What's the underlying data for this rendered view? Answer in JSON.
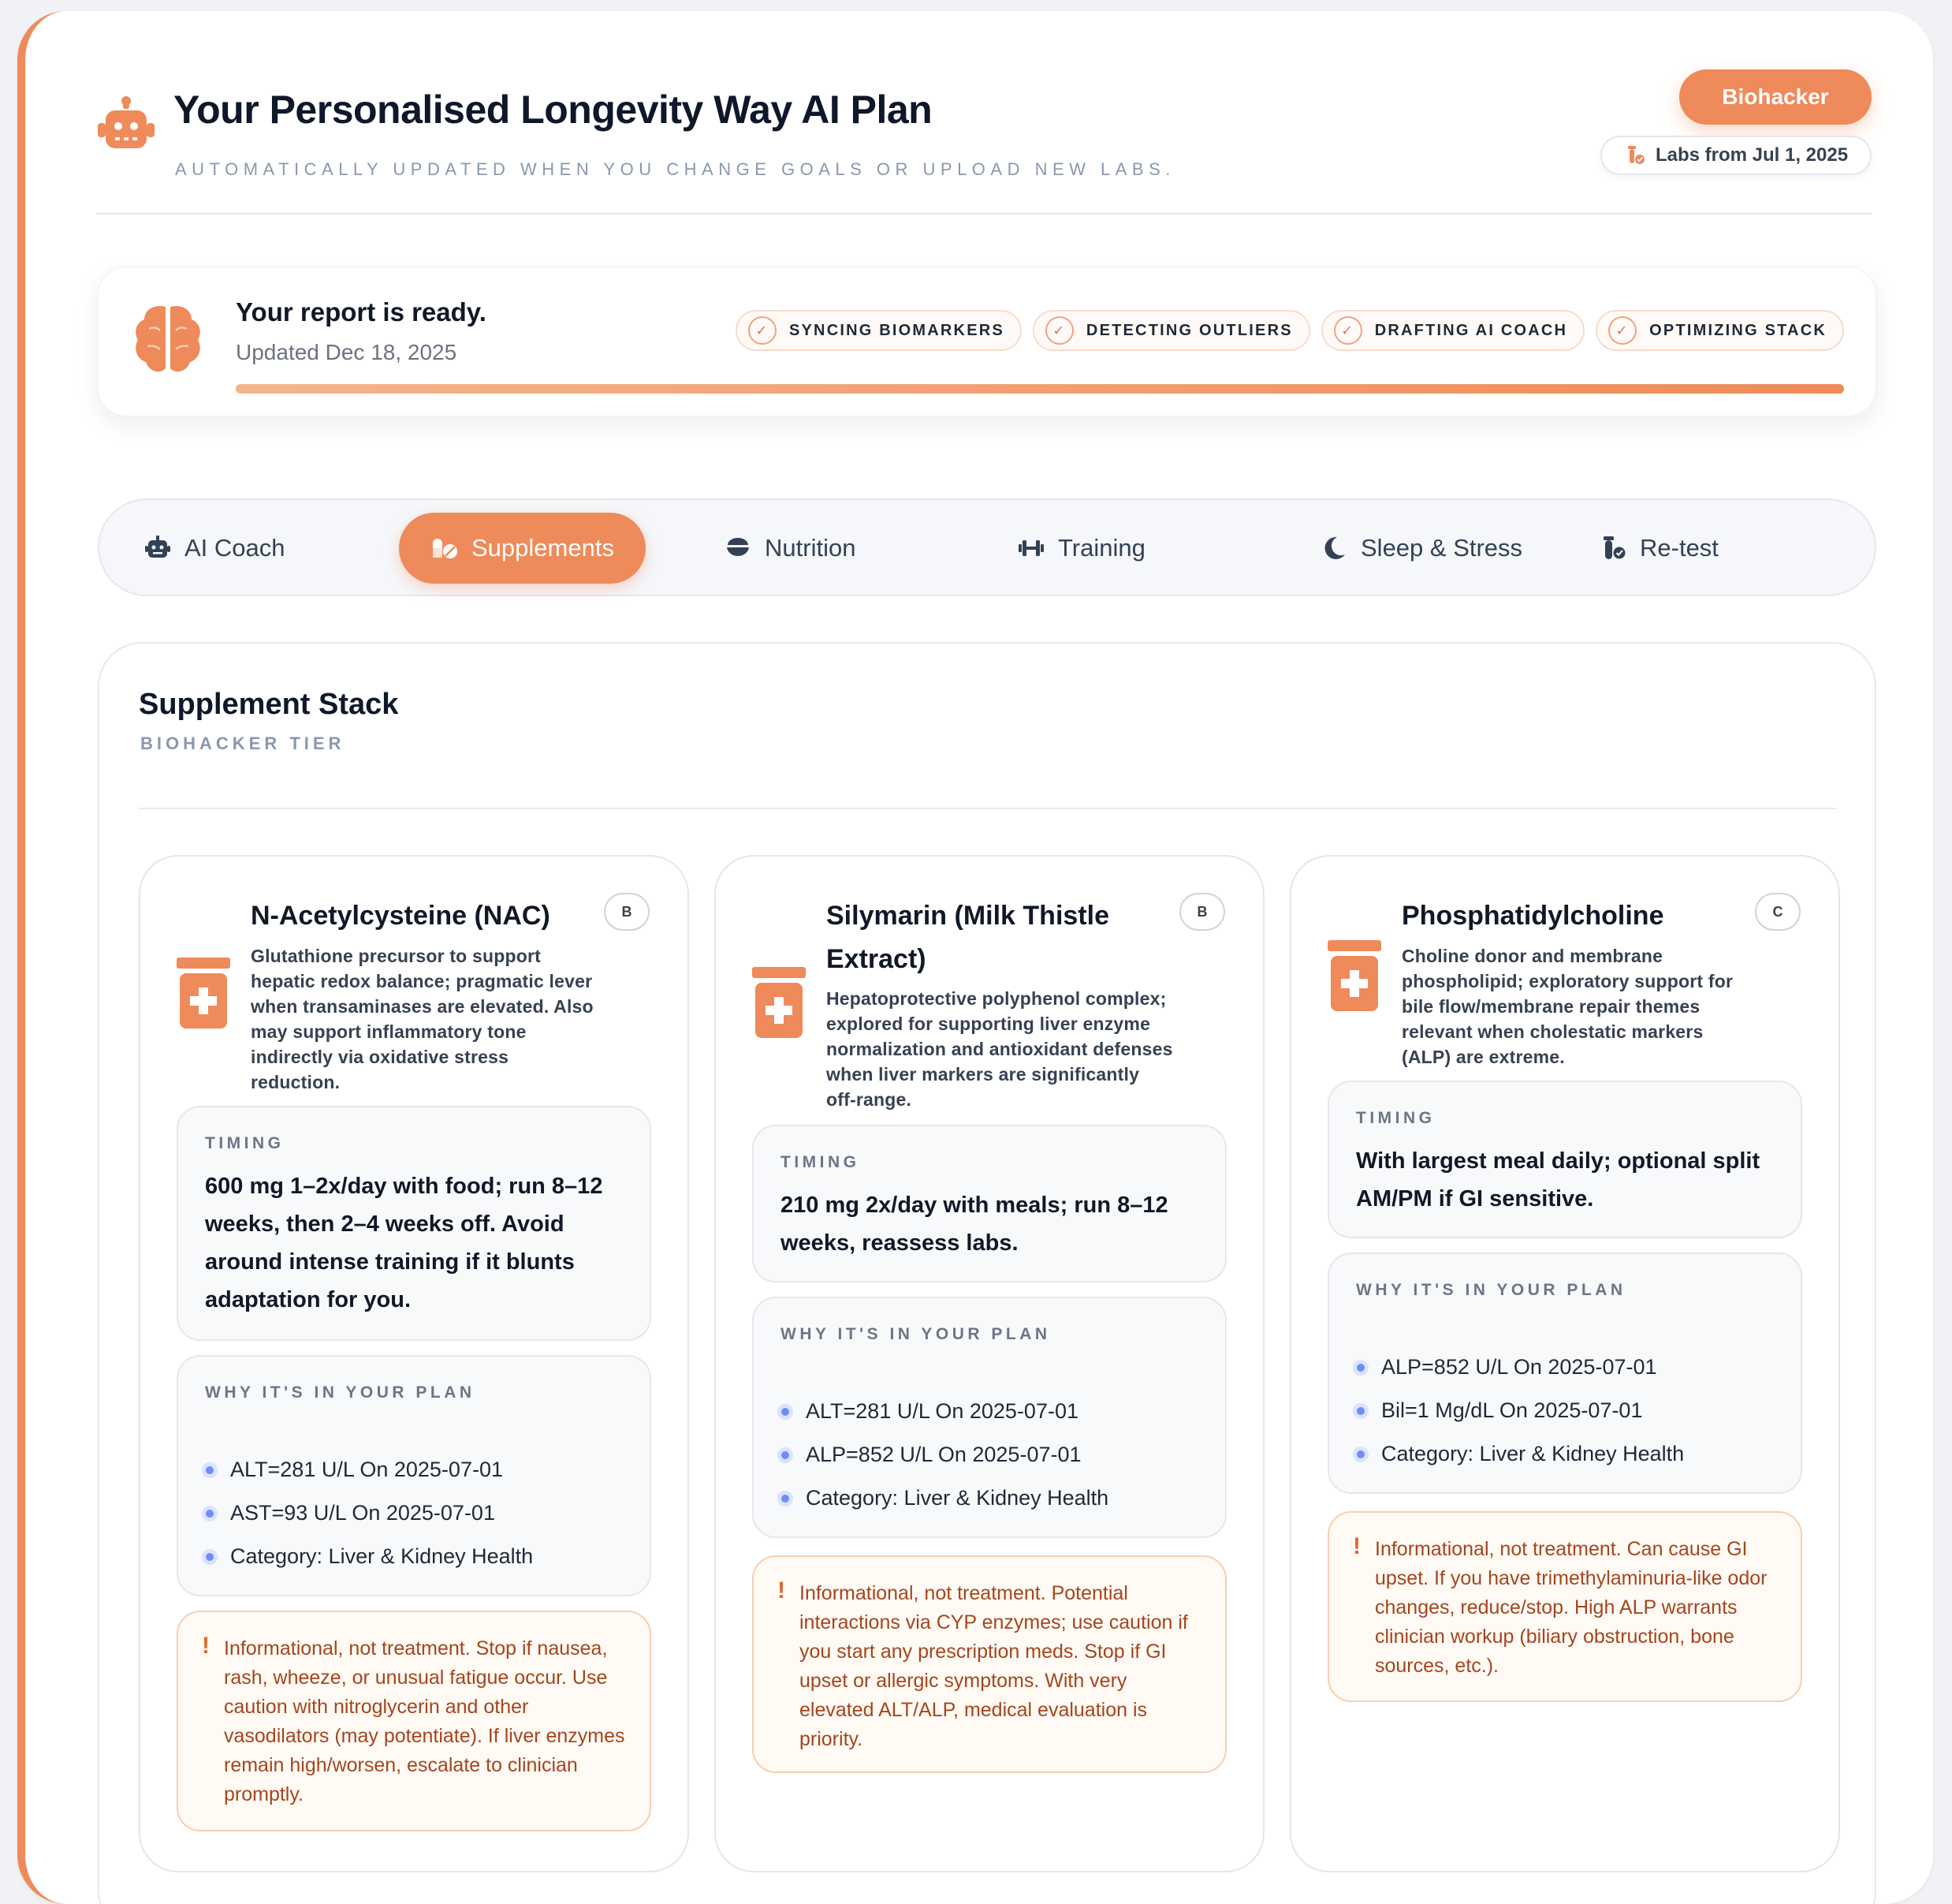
{
  "header": {
    "title": "Your Personalised Longevity Way AI Plan",
    "subtitle": "AUTOMATICALLY UPDATED WHEN YOU CHANGE GOALS OR UPLOAD NEW LABS.",
    "tier_button": "Biohacker",
    "labs_label": "Labs from Jul 1, 2025",
    "icon": "robot-icon"
  },
  "report": {
    "title": "Your report is ready.",
    "updated": "Updated Dec 18, 2025",
    "progress": 1.0,
    "steps": [
      {
        "label": "SYNCING BIOMARKERS"
      },
      {
        "label": "DETECTING OUTLIERS"
      },
      {
        "label": "DRAFTING AI COACH"
      },
      {
        "label": "OPTIMIZING STACK"
      }
    ]
  },
  "tabs": [
    {
      "label": "AI Coach",
      "icon": "robot-icon"
    },
    {
      "label": "Supplements",
      "icon": "pills-icon",
      "active": true
    },
    {
      "label": "Nutrition",
      "icon": "bowl-icon"
    },
    {
      "label": "Training",
      "icon": "dumbbell-icon"
    },
    {
      "label": "Sleep & Stress",
      "icon": "moon-icon"
    },
    {
      "label": "Re-test",
      "icon": "vial-icon"
    }
  ],
  "panel": {
    "title": "Supplement Stack",
    "subtitle": "BIOHACKER TIER",
    "timing_label": "TIMING",
    "why_label": "WHY IT'S IN YOUR PLAN"
  },
  "cards": [
    {
      "name": "N-Acetylcysteine (NAC)",
      "grade": "B",
      "description": "Glutathione precursor to support hepatic redox balance; pragmatic lever when transaminases are elevated. Also may support inflammatory tone indirectly via oxidative stress reduction.",
      "timing": "600 mg 1–2x/day with food; run 8–12 weeks, then 2–4 weeks off. Avoid around intense training if it blunts adaptation for you.",
      "reasons": [
        "ALT=281 U/L On 2025-07-01",
        "AST=93 U/L On 2025-07-01",
        "Category: Liver & Kidney Health"
      ],
      "warning": "Informational, not treatment. Stop if nausea, rash, wheeze, or unusual fatigue occur. Use caution with nitroglycerin and other vasodilators (may potentiate). If liver enzymes remain high/worsen, escalate to clinician promptly."
    },
    {
      "name": "Silymarin (Milk Thistle Extract)",
      "grade": "B",
      "description": "Hepatoprotective polyphenol complex; explored for supporting liver enzyme normalization and antioxidant defenses when liver markers are significantly off-range.",
      "timing": "210 mg 2x/day with meals; run 8–12 weeks, reassess labs.",
      "reasons": [
        "ALT=281 U/L On 2025-07-01",
        "ALP=852 U/L On 2025-07-01",
        "Category: Liver & Kidney Health"
      ],
      "warning": "Informational, not treatment. Potential interactions via CYP enzymes; use caution if you start any prescription meds. Stop if GI upset or allergic symptoms. With very elevated ALT/ALP, medical evaluation is priority."
    },
    {
      "name": "Phosphatidylcholine",
      "grade": "C",
      "description": "Choline donor and membrane phospholipid; exploratory support for bile flow/membrane repair themes relevant when cholestatic markers (ALP) are extreme.",
      "timing": "With largest meal daily; optional split AM/PM if GI sensitive.",
      "reasons": [
        "ALP=852 U/L On 2025-07-01",
        "Bil=1 Mg/dL On 2025-07-01",
        "Category: Liver & Kidney Health"
      ],
      "warning": "Informational, not treatment. Can cause GI upset. If you have trimethylaminuria-like odor changes, reduce/stop. High ALP warrants clinician workup (biliary obstruction, bone sources, etc.)."
    }
  ],
  "colors": {
    "accent": "#ef8a5a",
    "warning_text": "#a5451e",
    "reason_dot": "#6e8ef5"
  }
}
